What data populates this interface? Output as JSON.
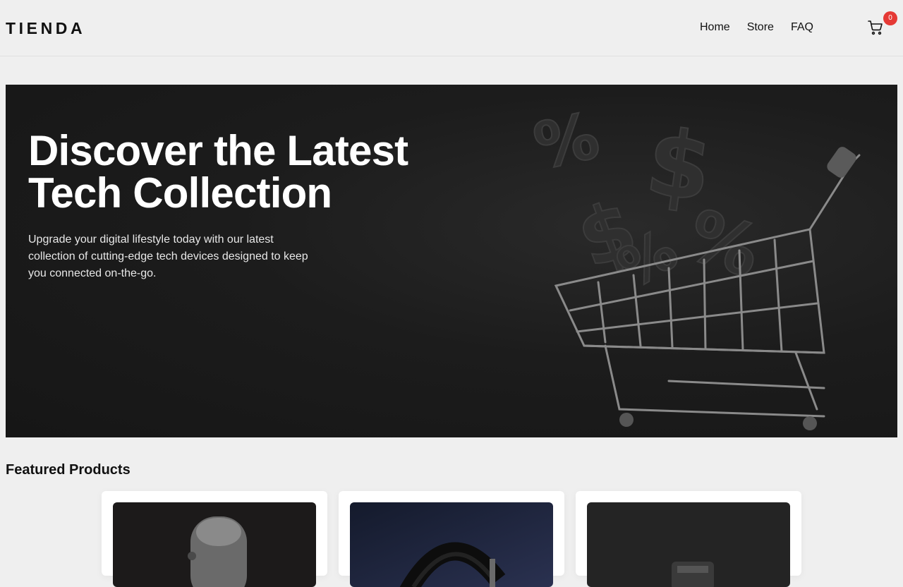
{
  "header": {
    "logo": "TIENDA",
    "nav": [
      "Home",
      "Store",
      "FAQ"
    ],
    "cart": {
      "icon": "cart-icon",
      "count": "0"
    }
  },
  "hero": {
    "title": "Discover the Latest Tech Collection",
    "subtitle": "Upgrade your digital lifestyle today with our latest collection of cutting-edge tech devices designed to keep you connected on-the-go.",
    "image": "shopping-cart-with-percent-and-dollar-symbols"
  },
  "featured": {
    "title": "Featured Products",
    "products": [
      {
        "image": "microphone"
      },
      {
        "image": "headphones"
      },
      {
        "image": "camera-lens"
      }
    ]
  },
  "colors": {
    "background": "#efefef",
    "hero_bg": "#1c1c1c",
    "badge": "#e53935",
    "card": "#ffffff"
  }
}
